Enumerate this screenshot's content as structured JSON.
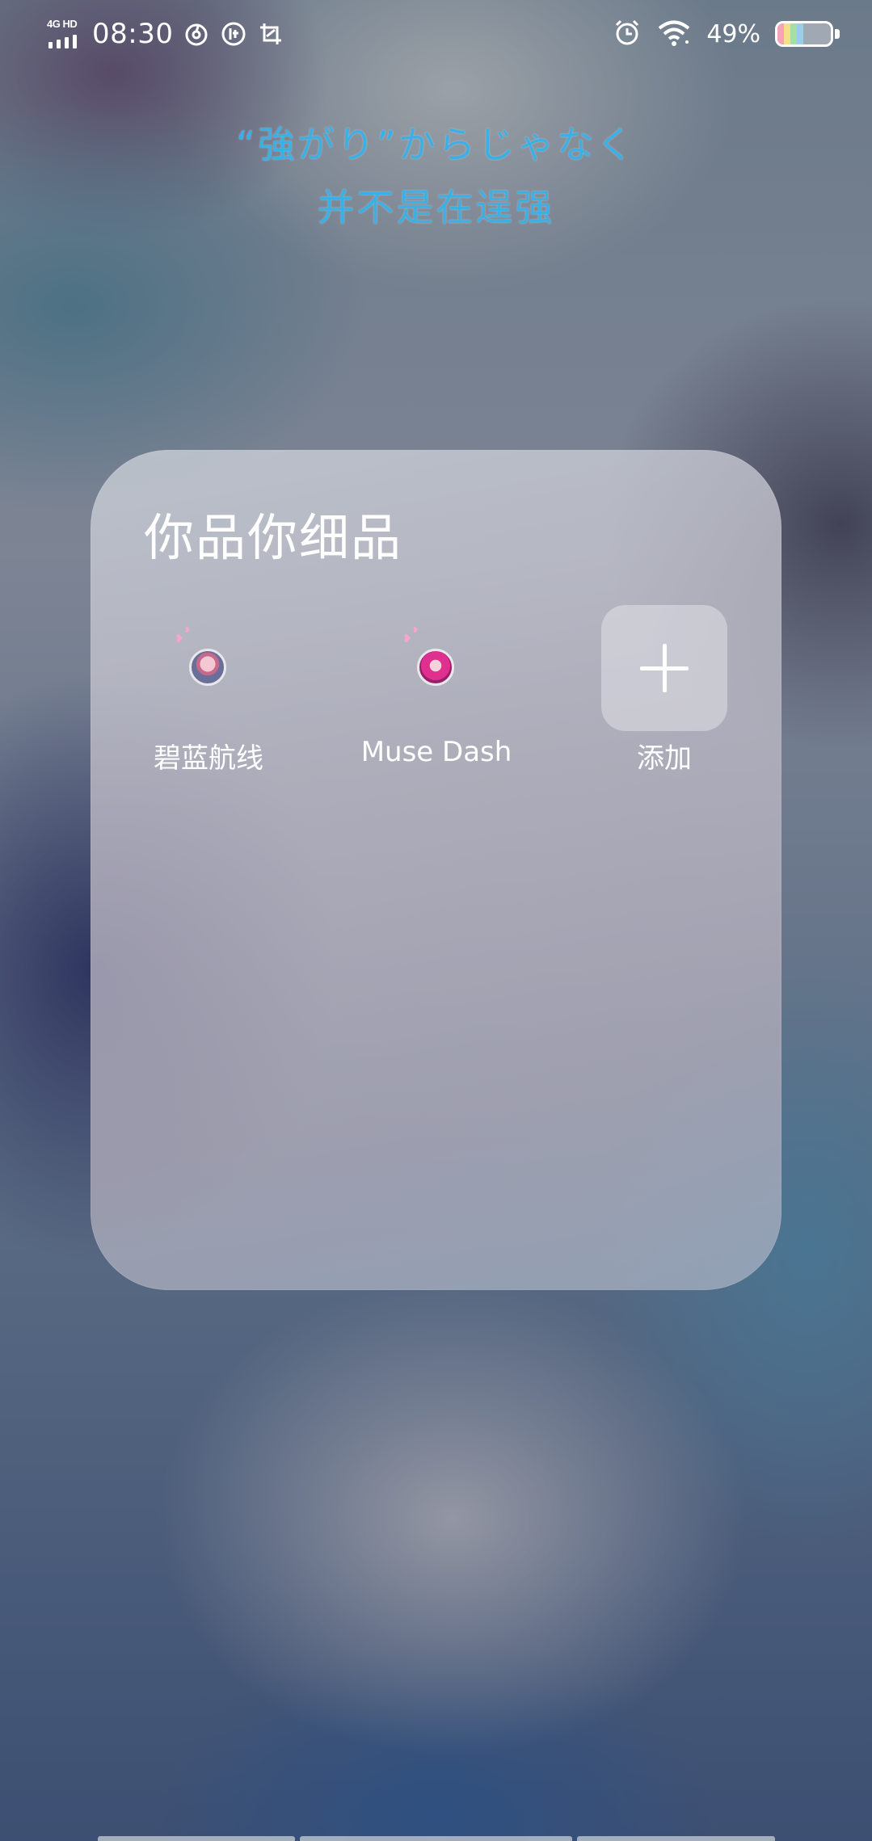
{
  "status_bar": {
    "network": "4G HD",
    "time": "08:30",
    "notification_icons": [
      "netease-music-icon",
      "speed-badge-icon",
      "screenshot-crop-icon"
    ],
    "right_icons": [
      "alarm-icon",
      "wifi-icon"
    ],
    "battery_percent": "49%",
    "battery_level": 0.49,
    "battery_colors": [
      "#f6a3b8",
      "#f5de8c",
      "#a8dca9",
      "#9ccde8"
    ]
  },
  "lyrics": {
    "line1": "“強がり”からじゃなく",
    "line2": "并不是在逞强",
    "color": "#3bb0e6"
  },
  "folder": {
    "title": "你品你细品",
    "apps": [
      {
        "label": "碧蓝航线",
        "icon": "azur-lane-app-icon"
      },
      {
        "label": "Muse Dash",
        "icon": "muse-dash-app-icon"
      }
    ],
    "add_label": "添加"
  }
}
